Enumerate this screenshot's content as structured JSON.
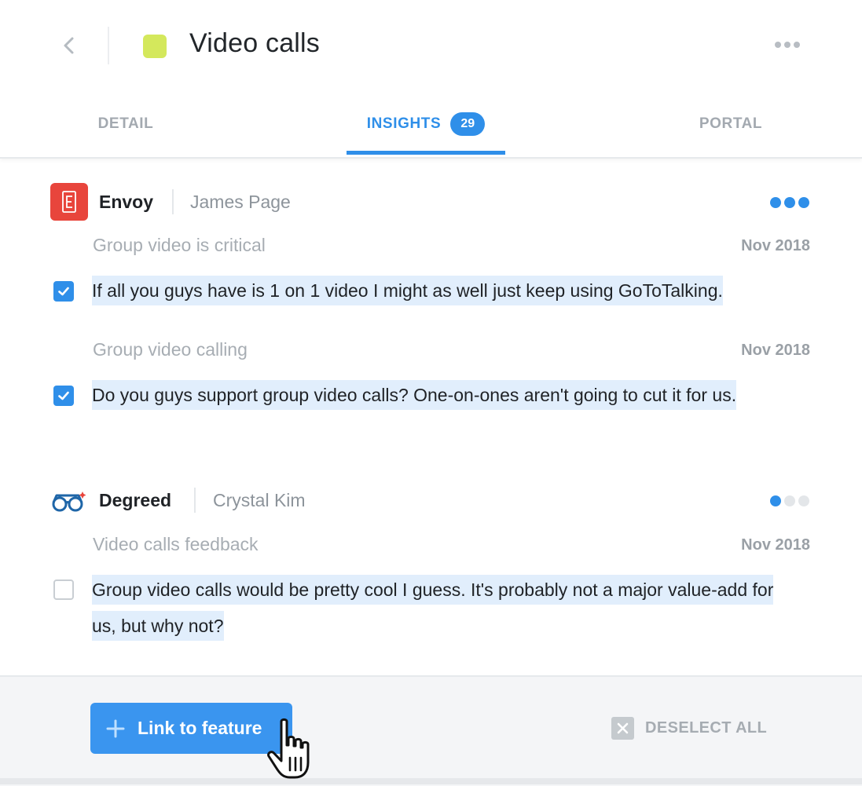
{
  "header": {
    "title": "Video calls",
    "swatch_color": "#d4e85c",
    "back_icon": "chevron-left-icon",
    "more_icon": "ellipsis-icon"
  },
  "tabs": [
    {
      "label": "DETAIL",
      "active": false
    },
    {
      "label": "INSIGHTS",
      "active": true,
      "badge": "29"
    },
    {
      "label": "PORTAL",
      "active": false
    }
  ],
  "groups": [
    {
      "company": "Envoy",
      "person": "James Page",
      "logo_icon": "envoy-logo-icon",
      "logo_color": "#e8453c",
      "importance_level": 3,
      "importance_max": 3,
      "insights": [
        {
          "title": "Group video is critical",
          "date": "Nov 2018",
          "checked": true,
          "quote": "If all you guys have is 1 on 1 video I might as well just keep using GoToTalking."
        },
        {
          "title": "Group video calling",
          "date": "Nov 2018",
          "checked": true,
          "quote": "Do you guys support group video calls? One-on-ones aren't going to cut it for us."
        }
      ]
    },
    {
      "company": "Degreed",
      "person": "Crystal Kim",
      "logo_icon": "degreed-glasses-logo-icon",
      "logo_color": "#1f66a8",
      "importance_level": 1,
      "importance_max": 3,
      "insights": [
        {
          "title": "Video calls feedback",
          "date": "Nov 2018",
          "checked": false,
          "quote": "Group video calls would be pretty cool I guess. It's probably not a major value-add for us, but why not?"
        }
      ]
    }
  ],
  "footer": {
    "link_button_label": "Link to feature",
    "deselect_label": "DESELECT ALL"
  },
  "colors": {
    "accent": "#2f8fe9",
    "dot_active": "#2f8fe9",
    "dot_inactive": "#e3e6e9",
    "highlight": "#e1eefc"
  }
}
